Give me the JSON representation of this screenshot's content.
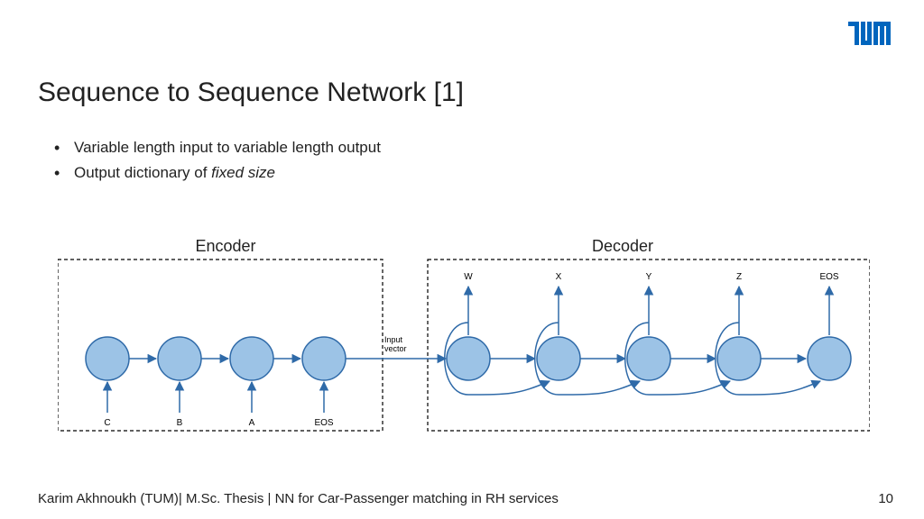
{
  "slide": {
    "title": "Sequence to Sequence Network [1]",
    "bullets": {
      "b1": "Variable length input to variable length output",
      "b2_prefix": "Output dictionary of ",
      "b2_em": "fixed size"
    },
    "footer": "Karim Akhnoukh (TUM)| M.Sc. Thesis | NN for Car-Passenger matching in RH services",
    "page": "10"
  },
  "diagram": {
    "encoder_label": "Encoder",
    "decoder_label": "Decoder",
    "bridge_label": "Input\nvector",
    "encoder_inputs": [
      "C",
      "B",
      "A",
      "EOS"
    ],
    "decoder_outputs": [
      "W",
      "X",
      "Y",
      "Z",
      "EOS"
    ],
    "colors": {
      "node_fill": "#9cc3e6",
      "node_stroke": "#2f6aa8",
      "arrow": "#2f6aa8",
      "box_stroke": "#000000"
    }
  },
  "brand": {
    "color": "#0065bd"
  }
}
